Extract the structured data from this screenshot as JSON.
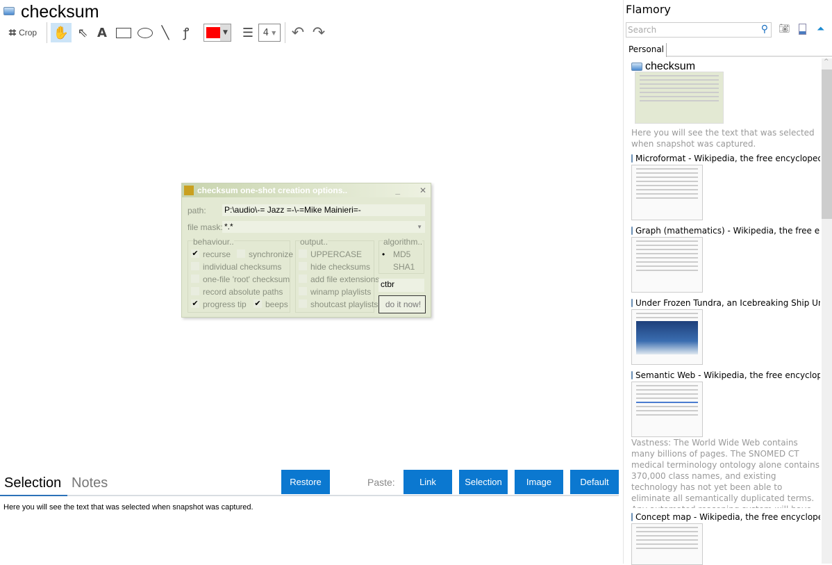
{
  "window": {
    "title": "checksum"
  },
  "toolbar": {
    "crop": "Crop",
    "color": "#ff0000",
    "line_width": "4"
  },
  "dialog": {
    "title": "checksum one-shot creation options..",
    "path_label": "path:",
    "path_value": "P:\\audio\\-= Jazz =-\\-=Mike Mainieri=-",
    "mask_label": "file mask:",
    "mask_value": "*.*",
    "behaviour": {
      "label": "behaviour..",
      "items": [
        {
          "label": "recurse",
          "checked": true
        },
        {
          "label": "synchronize",
          "checked": false
        },
        {
          "label": "individual checksums",
          "checked": false
        },
        {
          "label": "one-file 'root' checksum",
          "checked": false
        },
        {
          "label": "record absolute paths",
          "checked": false
        },
        {
          "label": "progress tip",
          "checked": true
        },
        {
          "label": "beeps",
          "checked": true
        }
      ]
    },
    "output": {
      "label": "output..",
      "items": [
        {
          "label": "UPPERCASE"
        },
        {
          "label": "hide checksums"
        },
        {
          "label": "add file extensions"
        },
        {
          "label": "winamp playlists"
        },
        {
          "label": "shoutcast playlists"
        }
      ]
    },
    "algorithm": {
      "label": "algorithm..",
      "items": [
        {
          "label": "MD5",
          "selected": true
        },
        {
          "label": "SHA1",
          "selected": false
        }
      ]
    },
    "ext_value": "ctbr",
    "go": "do it now!"
  },
  "bottom": {
    "tabs": [
      "Selection",
      "Notes"
    ],
    "restore": "Restore",
    "paste_label": "Paste:",
    "paste": [
      "Link",
      "Selection",
      "Image",
      "Default"
    ],
    "text": "Here you will see the text that was selected when snapshot was captured."
  },
  "sidebar": {
    "title": "Flamory",
    "search_placeholder": "Search",
    "tab": "Personal",
    "items": [
      {
        "title": "checksum",
        "desc": "Here you will see the text that was selected when snapshot was captured."
      },
      {
        "title": "Microformat - Wikipedia, the free encyclopedia"
      },
      {
        "title": "Graph (mathematics) - Wikipedia, the free encyclopedia"
      },
      {
        "title": "Under Frozen Tundra, an Icebreaking Ship Uncovers"
      },
      {
        "title": "Semantic Web - Wikipedia, the free encyclopedia",
        "desc": "Vastness: The World Wide Web contains many billions of pages. The SNOMED CT medical terminology ontology alone contains 370,000 class names, and existing technology has not yet been able to eliminate all semantically duplicated terms. Any automated reasoning system will have to deal with truly huge inputs."
      },
      {
        "title": "Concept map - Wikipedia, the free encyclopedia"
      }
    ]
  }
}
